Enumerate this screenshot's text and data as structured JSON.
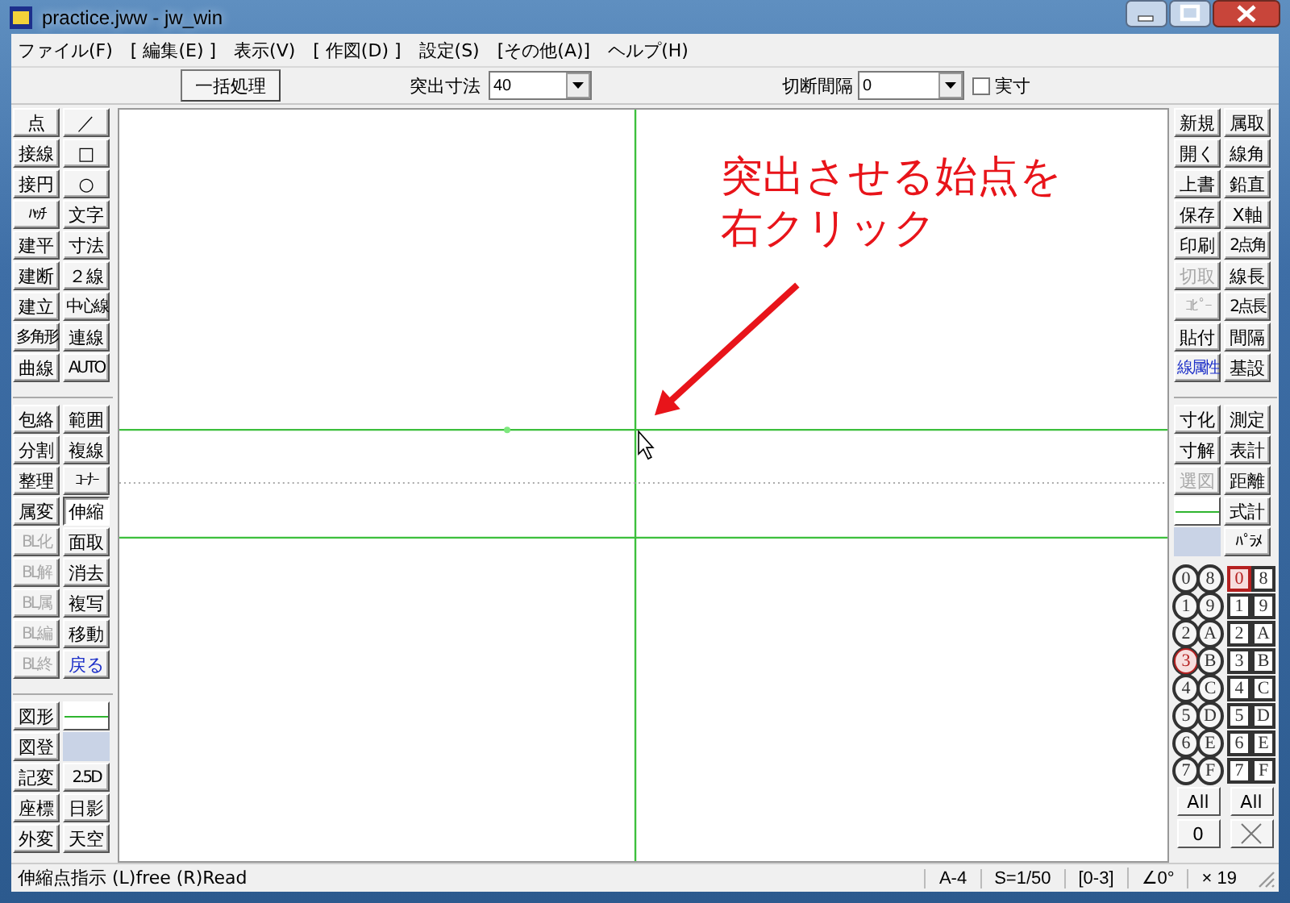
{
  "window": {
    "title": "practice.jww - jw_win"
  },
  "menu": [
    "ファイル(F)",
    "[ 編集(E) ]",
    "表示(V)",
    "[ 作図(D) ]",
    "設定(S)",
    "[その他(A)]",
    "ヘルプ(H)"
  ],
  "toolbar": {
    "batch_button": "一括処理",
    "protrusion": {
      "label": "突出寸法",
      "value": "40"
    },
    "cut_interval": {
      "label": "切断間隔",
      "value": "0"
    },
    "actual_size": {
      "label": "実寸",
      "checked": false
    }
  },
  "left_tools": [
    [
      {
        "kind": "button",
        "label": "点",
        "selected": false,
        "disabled": false
      },
      {
        "kind": "button",
        "label": "／",
        "selected": false,
        "disabled": false
      }
    ],
    [
      {
        "kind": "button",
        "label": "接線",
        "selected": false,
        "disabled": false
      },
      {
        "kind": "button",
        "label": "□",
        "selected": false,
        "disabled": false
      }
    ],
    [
      {
        "kind": "button",
        "label": "接円",
        "selected": false,
        "disabled": false
      },
      {
        "kind": "button",
        "label": "○",
        "selected": false,
        "disabled": false
      }
    ],
    [
      {
        "kind": "button",
        "label": "ﾊｯﾁ",
        "selected": false,
        "disabled": false
      },
      {
        "kind": "button",
        "label": "文字",
        "selected": false,
        "disabled": false
      }
    ],
    [
      {
        "kind": "button",
        "label": "建平",
        "selected": false,
        "disabled": false
      },
      {
        "kind": "button",
        "label": "寸法",
        "selected": false,
        "disabled": false
      }
    ],
    [
      {
        "kind": "button",
        "label": "建断",
        "selected": false,
        "disabled": false
      },
      {
        "kind": "button",
        "label": "２線",
        "selected": false,
        "disabled": false
      }
    ],
    [
      {
        "kind": "button",
        "label": "建立",
        "selected": false,
        "disabled": false
      },
      {
        "kind": "button",
        "label": "中心線",
        "selected": false,
        "disabled": false
      }
    ],
    [
      {
        "kind": "button",
        "label": "多角形",
        "selected": false,
        "disabled": false
      },
      {
        "kind": "button",
        "label": "連線",
        "selected": false,
        "disabled": false
      }
    ],
    [
      {
        "kind": "button",
        "label": "曲線",
        "selected": false,
        "disabled": false
      },
      {
        "kind": "button",
        "label": "AUTO",
        "selected": false,
        "disabled": false
      }
    ],
    [
      {
        "kind": "separator"
      }
    ],
    [
      {
        "kind": "button",
        "label": "包絡",
        "selected": false,
        "disabled": false
      },
      {
        "kind": "button",
        "label": "範囲",
        "selected": false,
        "disabled": false
      }
    ],
    [
      {
        "kind": "button",
        "label": "分割",
        "selected": false,
        "disabled": false
      },
      {
        "kind": "button",
        "label": "複線",
        "selected": false,
        "disabled": false
      }
    ],
    [
      {
        "kind": "button",
        "label": "整理",
        "selected": false,
        "disabled": false
      },
      {
        "kind": "button",
        "label": "ｺｰﾅｰ",
        "selected": false,
        "disabled": false
      }
    ],
    [
      {
        "kind": "button",
        "label": "属変",
        "selected": false,
        "disabled": false
      },
      {
        "kind": "button",
        "label": "伸縮",
        "selected": true,
        "disabled": false
      }
    ],
    [
      {
        "kind": "button",
        "label": "BL化",
        "selected": false,
        "disabled": true
      },
      {
        "kind": "button",
        "label": "面取",
        "selected": false,
        "disabled": false
      }
    ],
    [
      {
        "kind": "button",
        "label": "BL解",
        "selected": false,
        "disabled": true
      },
      {
        "kind": "button",
        "label": "消去",
        "selected": false,
        "disabled": false
      }
    ],
    [
      {
        "kind": "button",
        "label": "BL属",
        "selected": false,
        "disabled": true
      },
      {
        "kind": "button",
        "label": "複写",
        "selected": false,
        "disabled": false
      }
    ],
    [
      {
        "kind": "button",
        "label": "BL編",
        "selected": false,
        "disabled": true
      },
      {
        "kind": "button",
        "label": "移動",
        "selected": false,
        "disabled": false
      }
    ],
    [
      {
        "kind": "button",
        "label": "BL終",
        "selected": false,
        "disabled": true
      },
      {
        "kind": "accent",
        "label": "戻る",
        "selected": false,
        "disabled": false
      }
    ],
    [
      {
        "kind": "separator"
      }
    ],
    [
      {
        "kind": "button",
        "label": "図形",
        "selected": false,
        "disabled": false
      },
      {
        "kind": "line"
      }
    ],
    [
      {
        "kind": "button",
        "label": "図登",
        "selected": false,
        "disabled": false
      },
      {
        "kind": "bar"
      }
    ],
    [
      {
        "kind": "button",
        "label": "記変",
        "selected": false,
        "disabled": false
      },
      {
        "kind": "button",
        "label": "2.5D",
        "selected": false,
        "disabled": false
      }
    ],
    [
      {
        "kind": "button",
        "label": "座標",
        "selected": false,
        "disabled": false
      },
      {
        "kind": "button",
        "label": "日影",
        "selected": false,
        "disabled": false
      }
    ],
    [
      {
        "kind": "button",
        "label": "外変",
        "selected": false,
        "disabled": false
      },
      {
        "kind": "button",
        "label": "天空",
        "selected": false,
        "disabled": false
      }
    ]
  ],
  "right_tools": [
    [
      {
        "kind": "button",
        "label": "新規",
        "selected": false,
        "disabled": false
      },
      {
        "kind": "button",
        "label": "属取",
        "selected": false,
        "disabled": false
      }
    ],
    [
      {
        "kind": "button",
        "label": "開く",
        "selected": false,
        "disabled": false
      },
      {
        "kind": "button",
        "label": "線角",
        "selected": false,
        "disabled": false
      }
    ],
    [
      {
        "kind": "button",
        "label": "上書",
        "selected": false,
        "disabled": false
      },
      {
        "kind": "button",
        "label": "鉛直",
        "selected": false,
        "disabled": false
      }
    ],
    [
      {
        "kind": "button",
        "label": "保存",
        "selected": false,
        "disabled": false
      },
      {
        "kind": "button",
        "label": "X軸",
        "selected": false,
        "disabled": false
      }
    ],
    [
      {
        "kind": "button",
        "label": "印刷",
        "selected": false,
        "disabled": false
      },
      {
        "kind": "button",
        "label": "2点角",
        "selected": false,
        "disabled": false
      }
    ],
    [
      {
        "kind": "button",
        "label": "切取",
        "selected": false,
        "disabled": true
      },
      {
        "kind": "button",
        "label": "線長",
        "selected": false,
        "disabled": false
      }
    ],
    [
      {
        "kind": "button",
        "label": "ｺﾋﾟｰ",
        "selected": false,
        "disabled": true
      },
      {
        "kind": "button",
        "label": "2点長",
        "selected": false,
        "disabled": false
      }
    ],
    [
      {
        "kind": "button",
        "label": "貼付",
        "selected": false,
        "disabled": false
      },
      {
        "kind": "button",
        "label": "間隔",
        "selected": false,
        "disabled": false
      }
    ],
    [
      {
        "kind": "accent",
        "label": "線属性",
        "selected": false,
        "disabled": false
      },
      {
        "kind": "button",
        "label": "基設",
        "selected": false,
        "disabled": false
      }
    ],
    [
      {
        "kind": "separator"
      }
    ],
    [
      {
        "kind": "button",
        "label": "寸化",
        "selected": false,
        "disabled": false
      },
      {
        "kind": "button",
        "label": "測定",
        "selected": false,
        "disabled": false
      }
    ],
    [
      {
        "kind": "button",
        "label": "寸解",
        "selected": false,
        "disabled": false
      },
      {
        "kind": "button",
        "label": "表計",
        "selected": false,
        "disabled": false
      }
    ],
    [
      {
        "kind": "button",
        "label": "選図",
        "selected": false,
        "disabled": true
      },
      {
        "kind": "button",
        "label": "距離",
        "selected": false,
        "disabled": false
      }
    ],
    [
      {
        "kind": "line"
      },
      {
        "kind": "button",
        "label": "式計",
        "selected": false,
        "disabled": false
      }
    ],
    [
      {
        "kind": "bar"
      },
      {
        "kind": "button",
        "label": "ﾊﾟﾗﾒ",
        "selected": false,
        "disabled": false
      }
    ]
  ],
  "layers": [
    {
      "kind": "circled",
      "cells": [
        {
          "label": "0",
          "selected": false
        },
        {
          "label": "8",
          "selected": false
        },
        {
          "label": "1",
          "selected": false
        },
        {
          "label": "9",
          "selected": false
        },
        {
          "label": "2",
          "selected": false
        },
        {
          "label": "A",
          "selected": false
        },
        {
          "label": "3",
          "selected": true
        },
        {
          "label": "B",
          "selected": false
        },
        {
          "label": "4",
          "selected": false
        },
        {
          "label": "C",
          "selected": false
        },
        {
          "label": "5",
          "selected": false
        },
        {
          "label": "D",
          "selected": false
        },
        {
          "label": "6",
          "selected": false
        },
        {
          "label": "E",
          "selected": false
        },
        {
          "label": "7",
          "selected": false
        },
        {
          "label": "F",
          "selected": false
        }
      ],
      "buttons": [
        {
          "kind": "text",
          "label": "All"
        },
        {
          "kind": "text",
          "label": "0"
        }
      ]
    },
    {
      "kind": "square",
      "cells": [
        {
          "label": "0",
          "selected": true
        },
        {
          "label": "8",
          "selected": false
        },
        {
          "label": "1",
          "selected": false
        },
        {
          "label": "9",
          "selected": false
        },
        {
          "label": "2",
          "selected": false
        },
        {
          "label": "A",
          "selected": false
        },
        {
          "label": "3",
          "selected": false
        },
        {
          "label": "B",
          "selected": false
        },
        {
          "label": "4",
          "selected": false
        },
        {
          "label": "C",
          "selected": false
        },
        {
          "label": "5",
          "selected": false
        },
        {
          "label": "D",
          "selected": false
        },
        {
          "label": "6",
          "selected": false
        },
        {
          "label": "E",
          "selected": false
        },
        {
          "label": "7",
          "selected": false
        },
        {
          "label": "F",
          "selected": false
        }
      ],
      "buttons": [
        {
          "kind": "text",
          "label": "All"
        },
        {
          "kind": "cross"
        }
      ]
    }
  ],
  "canvas": {
    "annotation": [
      "突出させる始点を",
      "右クリック"
    ]
  },
  "status_bar": {
    "message": "伸縮点指示 (L)free (R)Read",
    "fields": [
      "A-4",
      "S=1/50",
      "[0-3]",
      "∠0°",
      "× 19"
    ]
  }
}
